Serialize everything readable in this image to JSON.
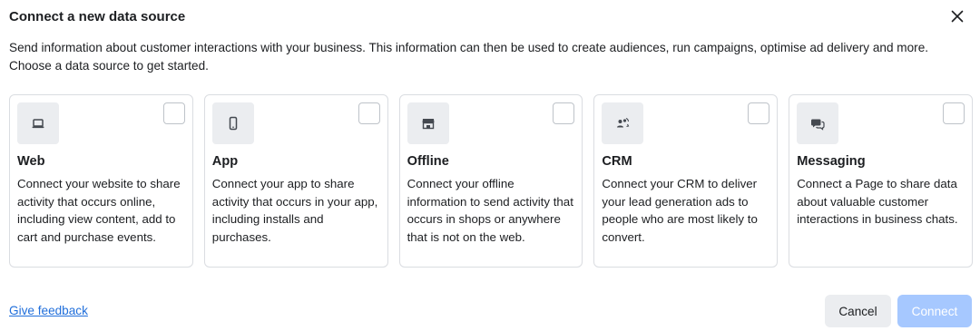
{
  "dialog": {
    "title": "Connect a new data source",
    "description": "Send information about customer interactions with your business. This information can then be used to create audiences, run campaigns, optimise ad delivery and more. Choose a data source to get started."
  },
  "cards": [
    {
      "icon": "laptop-icon",
      "title": "Web",
      "description": "Connect your website to share activity that occurs online, including view content, add to cart and purchase events.",
      "checked": false
    },
    {
      "icon": "mobile-phone-icon",
      "title": "App",
      "description": "Connect your app to share activity that occurs in your app, including installs and purchases.",
      "checked": false
    },
    {
      "icon": "store-icon",
      "title": "Offline",
      "description": "Connect your offline information to send activity that occurs in shops or anywhere that is not on the web.",
      "checked": false
    },
    {
      "icon": "people-sync-icon",
      "title": "CRM",
      "description": "Connect your CRM to deliver your lead generation ads to people who are most likely to convert.",
      "checked": false
    },
    {
      "icon": "chat-bubbles-icon",
      "title": "Messaging",
      "description": "Connect a Page to share data about valuable customer interactions in business chats.",
      "checked": false
    }
  ],
  "footer": {
    "feedback_label": "Give feedback",
    "cancel_label": "Cancel",
    "connect_label": "Connect"
  },
  "colors": {
    "link": "#216fdb",
    "connect_disabled": "#a6c8ff",
    "icon_bg": "#ebedf0",
    "card_border": "#dadde1"
  }
}
